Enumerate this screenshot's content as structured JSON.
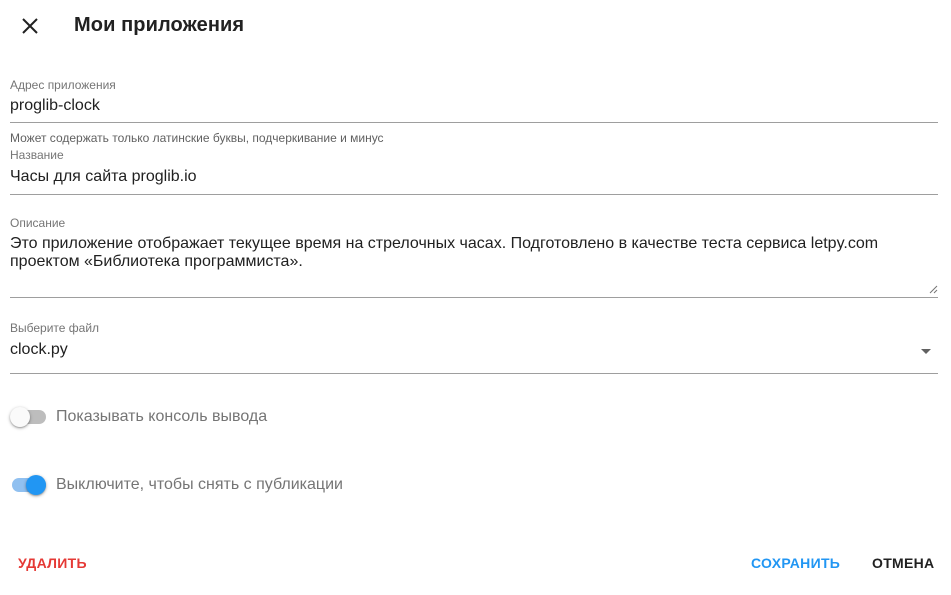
{
  "header": {
    "title": "Мои приложения",
    "close_icon": "close-icon"
  },
  "form": {
    "address": {
      "label": "Адрес приложения",
      "value": "proglib-clock",
      "hint": "Может содержать только латинские буквы, подчеркивание и минус"
    },
    "name": {
      "label": "Название",
      "value": "Часы для сайта proglib.io"
    },
    "description": {
      "label": "Описание",
      "value": "Это приложение отображает текущее время на стрелочных часах. Подготовлено в качестве теста сервиса letpy.com проектом «Библиотека программиста»."
    },
    "file": {
      "label": "Выберите файл",
      "value": "clock.py"
    }
  },
  "switches": {
    "console": {
      "label": "Показывать консоль вывода",
      "checked": false
    },
    "publish": {
      "label": "Выключите, чтобы снять с публикации",
      "checked": true
    }
  },
  "actions": {
    "delete_label": "УДАЛИТЬ",
    "save_label": "СОХРАНИТЬ",
    "cancel_label": "ОТМЕНА"
  },
  "colors": {
    "accent": "#2196f3",
    "danger": "#e53935",
    "text": "#212121",
    "muted": "#757575"
  }
}
